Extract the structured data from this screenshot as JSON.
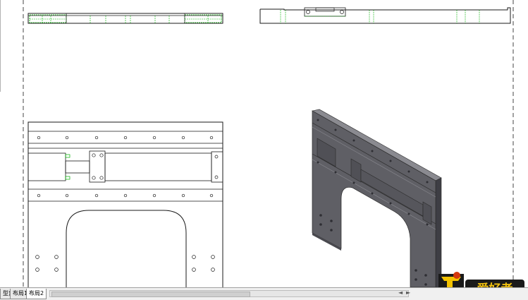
{
  "layout_tabs": [
    {
      "label": "型)",
      "active": false
    },
    {
      "label": "布局1",
      "active": false
    },
    {
      "label": "布局2",
      "active": true
    }
  ],
  "watermark": {
    "text": "爱好者"
  },
  "colors": {
    "line": "#1a1a1a",
    "hidden_line": "#00b000",
    "part_fill": "#5f5f65",
    "part_top": "#8a8a90",
    "part_side": "#3e3e44"
  }
}
